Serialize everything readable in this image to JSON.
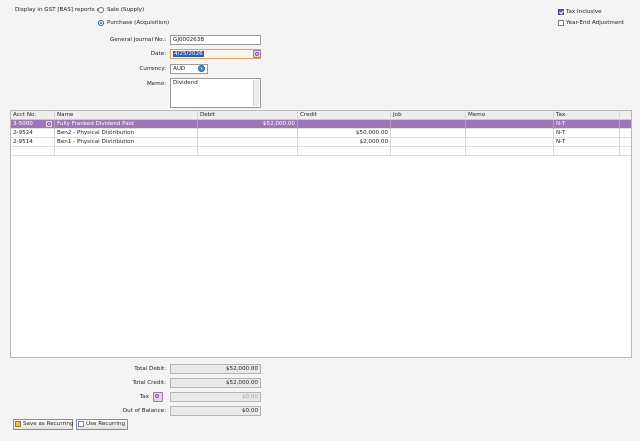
{
  "gst": {
    "prompt": "Display in GST [BAS] reports as:",
    "sale_label": "Sale (Supply)",
    "purchase_label": "Purchase (Acquisition)"
  },
  "options": {
    "tax_inclusive": "Tax Inclusive",
    "year_end": "Year-End Adjustment"
  },
  "form": {
    "journal_label": "General Journal No.:",
    "journal_value": "GJ000263B",
    "date_label": "Date:",
    "date_value": "4/25/2026",
    "currency_label": "Currency:",
    "currency_value": "AUD",
    "memo_label": "Memo:",
    "memo_value": "Dividend"
  },
  "table": {
    "columns": [
      "Acct No.",
      "Name",
      "Debit",
      "Credit",
      "Job",
      "Memo",
      "Tax"
    ],
    "rows": [
      {
        "acct": "3-5000",
        "name": "Fully Franked Dividend Paid",
        "debit": "$52,000.00",
        "credit": "",
        "job": "",
        "memo": "",
        "tax": "N-T"
      },
      {
        "acct": "2-9524",
        "name": "Ben2 - Physical Distribution",
        "debit": "",
        "credit": "$50,000.00",
        "job": "",
        "memo": "",
        "tax": "N-T"
      },
      {
        "acct": "2-9514",
        "name": "Ben1 - Physical Distribution",
        "debit": "",
        "credit": "$2,000.00",
        "job": "",
        "memo": "",
        "tax": "N-T"
      }
    ]
  },
  "totals": {
    "debit_label": "Total Debit:",
    "debit_value": "$52,000.00",
    "credit_label": "Total Credit:",
    "credit_value": "$52,000.00",
    "tax_label": "Tax",
    "tax_value": "$0.00",
    "oob_label": "Out of Balance:",
    "oob_value": "$0.00"
  },
  "buttons": {
    "save_recurring": "Save as Recurring",
    "use_recurring": "Use Recurring"
  },
  "colors": {
    "selection": "#9c78b8",
    "accent_blue": "#2a5fb0"
  }
}
